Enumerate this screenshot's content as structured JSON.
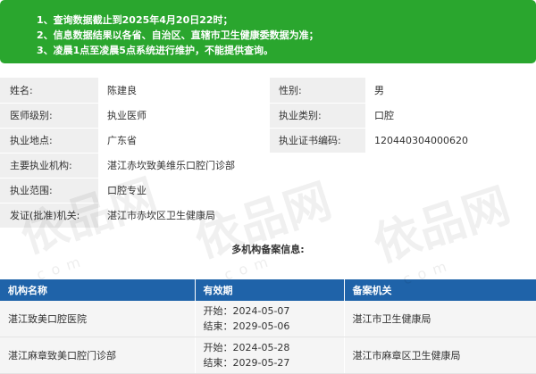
{
  "notice": {
    "lines": [
      "1、查询数据截止到2025年4月20日22时；",
      "2、信息数据结果以各省、自治区、直辖市卫生健康委数据为准；",
      "3、凌晨1点至凌晨5点系统进行维护，不能提供查询。"
    ]
  },
  "info": {
    "name_label": "姓名:",
    "name_value": "陈建良",
    "gender_label": "性别:",
    "gender_value": "男",
    "level_label": "医师级别:",
    "level_value": "执业医师",
    "category_label": "执业类别:",
    "category_value": "口腔",
    "location_label": "执业地点:",
    "location_value": "广东省",
    "cert_label": "执业证书编码:",
    "cert_value": "120440304000620",
    "org_label": "主要执业机构:",
    "org_value": "湛江赤坎致美维乐口腔门诊部",
    "scope_label": "执业范围:",
    "scope_value": "口腔专业",
    "issuer_label": "发证(批准)机关:",
    "issuer_value": "湛江市赤坎区卫生健康局"
  },
  "multi_org": {
    "title": "多机构备案信息:",
    "headers": [
      "机构名称",
      "有效期",
      "备案机关"
    ],
    "rows": [
      {
        "name": "湛江致美口腔医院",
        "start": "开始：2024-05-07",
        "end": "结束：2029-05-06",
        "authority": "湛江市卫生健康局"
      },
      {
        "name": "湛江麻章致美口腔门诊部",
        "start": "开始：2024-05-28",
        "end": "结束：2029-05-27",
        "authority": "湛江市麻章区卫生健康局"
      }
    ]
  },
  "watermark": {
    "text": "依品网",
    "sub": "com"
  }
}
